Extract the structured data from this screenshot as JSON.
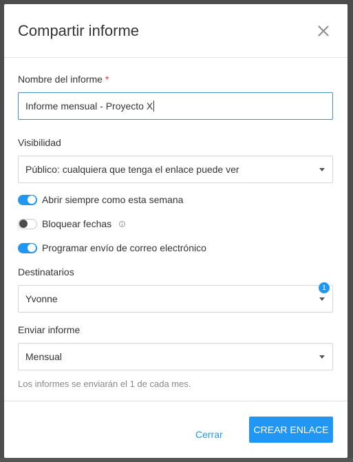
{
  "dialog": {
    "title": "Compartir informe",
    "close_icon": "close-icon"
  },
  "report_name": {
    "label": "Nombre del informe",
    "required_mark": "*",
    "value": "Informe mensual - Proyecto X"
  },
  "visibility": {
    "label": "Visibilidad",
    "selected": "Público: cualquiera que tenga el enlace puede ver"
  },
  "toggles": [
    {
      "label": "Abrir siempre como esta semana",
      "on": true
    },
    {
      "label": "Bloquear fechas",
      "on": false,
      "icon": "info-icon"
    },
    {
      "label": "Programar envío de correo electrónico",
      "on": true
    }
  ],
  "recipients": {
    "label": "Destinatarios",
    "selected": "Yvonne",
    "badge_count": "1"
  },
  "send_report": {
    "label": "Enviar informe",
    "selected": "Mensual",
    "help": "Los informes se enviarán el 1 de cada mes."
  },
  "footer": {
    "close_label": "Cerrar",
    "create_label": "CREAR ENLACE"
  },
  "colors": {
    "accent": "#2196f3",
    "required": "#e0393e",
    "overlay": "#4d4d4d"
  }
}
